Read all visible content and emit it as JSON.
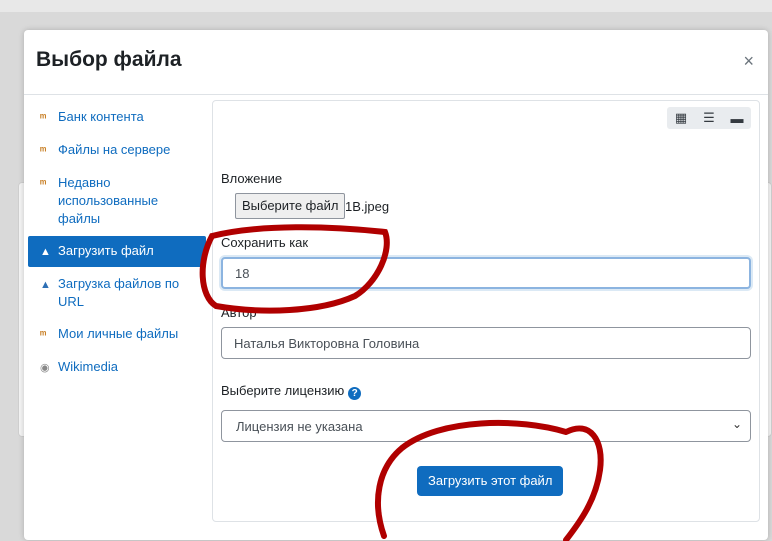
{
  "modal": {
    "title": "Выбор файла",
    "close_glyph": "×"
  },
  "sidebar": {
    "items": [
      {
        "label": "Банк контента",
        "icon": "moodle-icon"
      },
      {
        "label": "Файлы на сервере",
        "icon": "moodle-icon"
      },
      {
        "label": "Недавно использованные файлы",
        "icon": "moodle-icon"
      },
      {
        "label": "Загрузить файл",
        "icon": "upload-icon",
        "active": true
      },
      {
        "label": "Загрузка файлов по URL",
        "icon": "url-icon"
      },
      {
        "label": "Мои личные файлы",
        "icon": "moodle-icon"
      },
      {
        "label": "Wikimedia",
        "icon": "wikimedia-icon"
      }
    ]
  },
  "toolbar": {
    "icons": [
      "grid-view-icon",
      "list-view-icon",
      "folder-view-icon"
    ]
  },
  "form": {
    "attachment_label": "Вложение",
    "choose_file_button": "Выберите файл",
    "file_name": "1B.jpeg",
    "save_as_label": "Сохранить как",
    "save_as_value": "18",
    "author_label": "Автор",
    "author_value": "Наталья Викторовна Головина",
    "license_label": "Выберите лицензию",
    "license_value": "Лицензия не указана",
    "upload_button": "Загрузить этот файл"
  },
  "colors": {
    "accent": "#0f6cbf",
    "annotation": "#b00000"
  }
}
